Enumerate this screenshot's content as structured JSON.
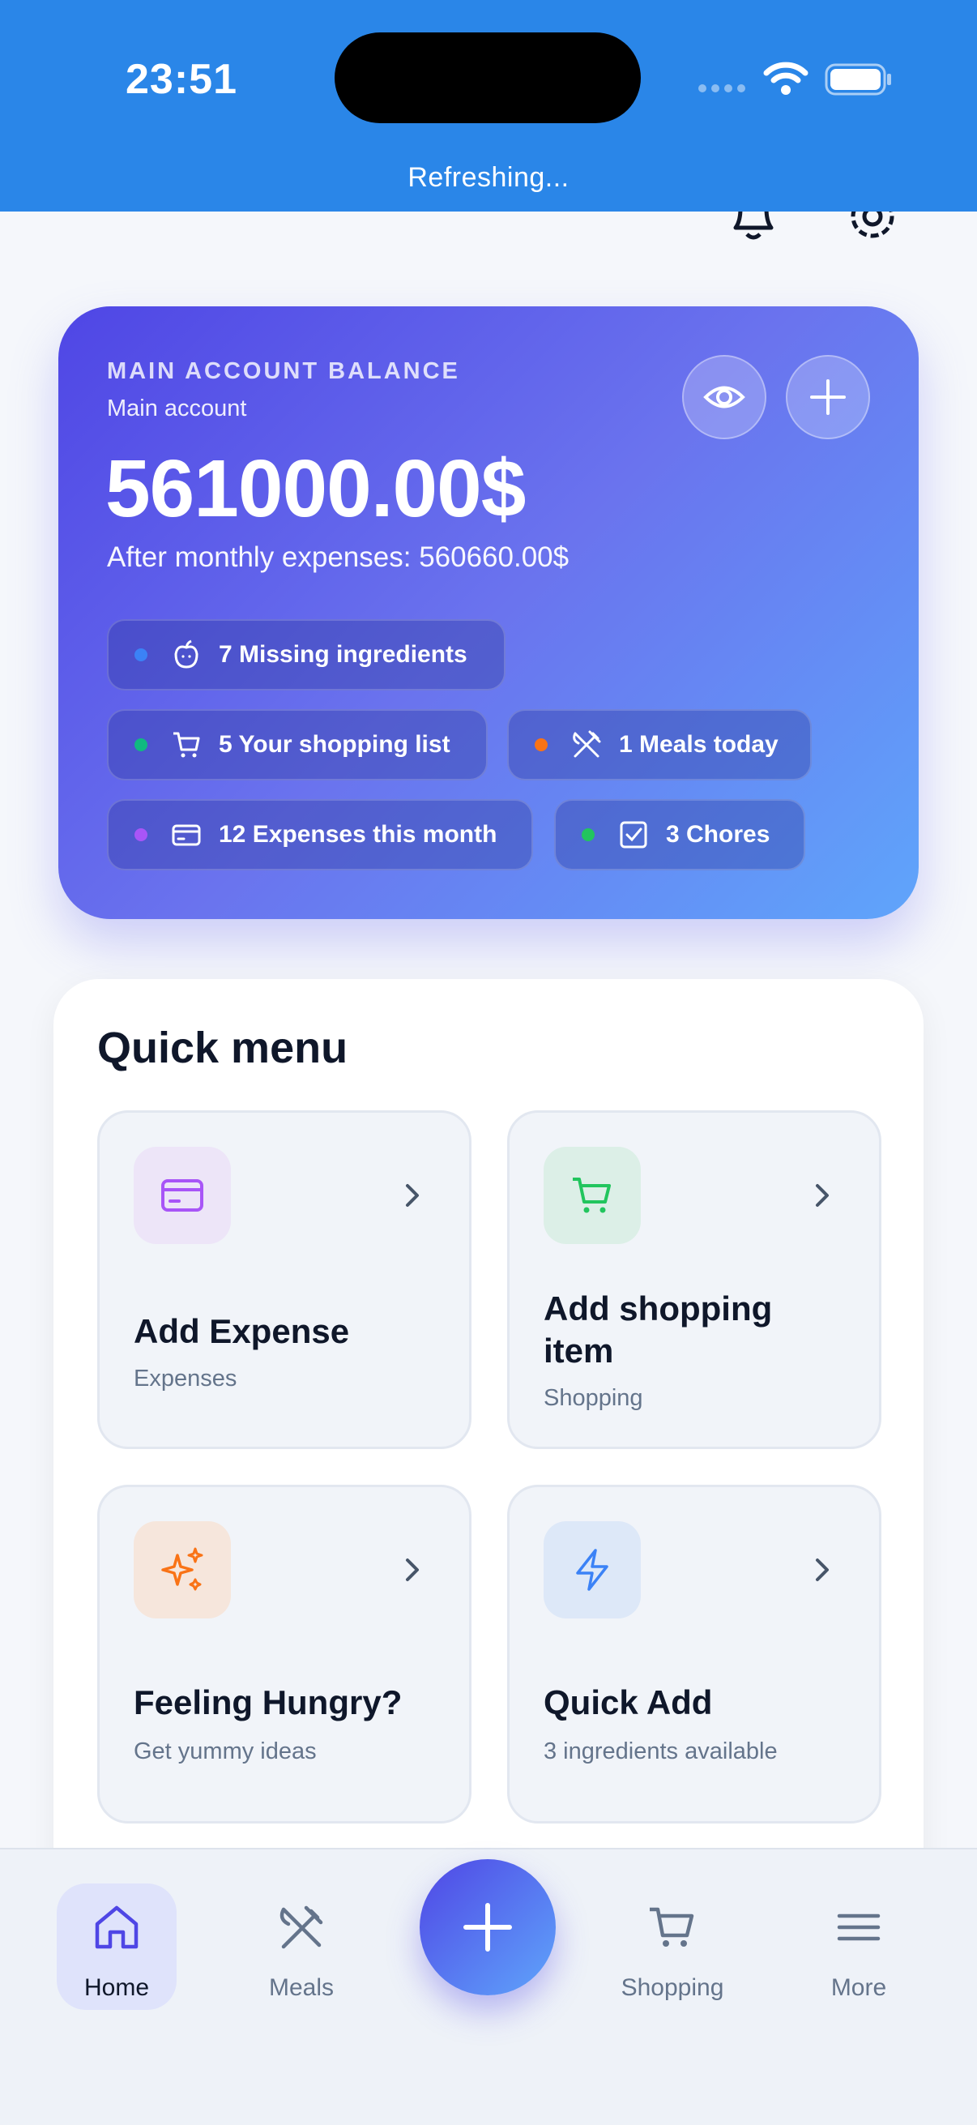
{
  "status_bar": {
    "time": "23:51",
    "refresh_text": "Refreshing..."
  },
  "balance": {
    "label": "MAIN ACCOUNT BALANCE",
    "account": "Main account",
    "amount": "561000.00$",
    "after_expenses": "After monthly expenses: 560660.00$",
    "chips": [
      {
        "label": "7 Missing ingredients",
        "dot_color": "#3b82f6",
        "icon": "apple-icon"
      },
      {
        "label": "5 Your shopping list",
        "dot_color": "#10b981",
        "icon": "cart-icon"
      },
      {
        "label": "1 Meals today",
        "dot_color": "#f97316",
        "icon": "utensils-icon"
      },
      {
        "label": "12 Expenses this month",
        "dot_color": "#a855f7",
        "icon": "card-icon"
      },
      {
        "label": "3 Chores",
        "dot_color": "#22c55e",
        "icon": "checkbox-icon"
      }
    ]
  },
  "quick_menu": {
    "title": "Quick menu",
    "tiles": [
      {
        "title": "Add Expense",
        "subtitle": "Expenses",
        "icon": "card-icon",
        "icon_color": "#a855f7",
        "icon_bg": "#ede5f8"
      },
      {
        "title": "Add shopping item",
        "subtitle": "Shopping",
        "icon": "cart-icon",
        "icon_color": "#22c55e",
        "icon_bg": "#dcefe7"
      },
      {
        "title": "Feeling Hungry?",
        "subtitle": "Get yummy ideas",
        "icon": "sparkles-icon",
        "icon_color": "#f97316",
        "icon_bg": "#f6e6dc"
      },
      {
        "title": "Quick Add",
        "subtitle": "3 ingredients available",
        "icon": "bolt-icon",
        "icon_color": "#3b82f6",
        "icon_bg": "#dde8f8"
      }
    ]
  },
  "nav": {
    "items": [
      {
        "label": "Home",
        "icon": "home-icon",
        "active": true
      },
      {
        "label": "Meals",
        "icon": "utensils-icon"
      },
      {
        "label": "Shopping",
        "icon": "cart-icon"
      },
      {
        "label": "More",
        "icon": "menu-icon"
      }
    ],
    "fab_icon": "plus-icon"
  },
  "colors": {
    "status_bar": "#2a86e8",
    "accent": "#4f46e5"
  }
}
